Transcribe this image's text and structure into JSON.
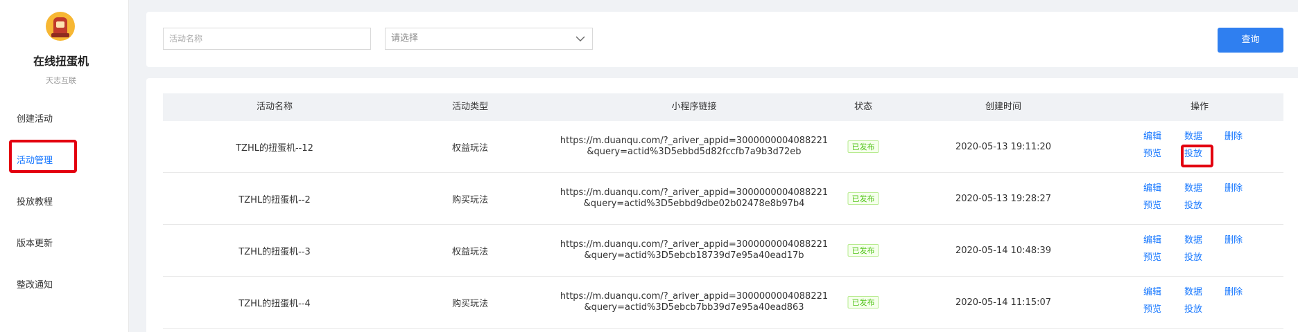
{
  "sidebar": {
    "app_title": "在线扭蛋机",
    "app_subtitle": "天志互联",
    "logo_icon": "gashapon-machine-icon",
    "items": [
      {
        "label": "创建活动",
        "active": false
      },
      {
        "label": "活动管理",
        "active": true
      },
      {
        "label": "投放教程",
        "active": false
      },
      {
        "label": "版本更新",
        "active": false
      },
      {
        "label": "整改通知",
        "active": false
      }
    ]
  },
  "filters": {
    "name_placeholder": "活动名称",
    "type_select_value": "请选择",
    "query_button": "查询"
  },
  "table": {
    "headers": [
      "活动名称",
      "活动类型",
      "小程序链接",
      "状态",
      "创建时间",
      "操作"
    ],
    "rows": [
      {
        "name": "TZHL的扭蛋机--12",
        "type": "权益玩法",
        "link_line1": "https://m.duanqu.com/?_ariver_appid=3000000004088221",
        "link_line2": "&query=actid%3D5ebbd5d82fccfb7a9b3d72eb",
        "status": "已发布",
        "created": "2020-05-13 19:11:20",
        "ops": [
          "编辑",
          "数据",
          "删除",
          "预览",
          "投放"
        ]
      },
      {
        "name": "TZHL的扭蛋机--2",
        "type": "购买玩法",
        "link_line1": "https://m.duanqu.com/?_ariver_appid=3000000004088221",
        "link_line2": "&query=actid%3D5ebbd9dbe02b02478e8b97b4",
        "status": "已发布",
        "created": "2020-05-13 19:28:27",
        "ops": [
          "编辑",
          "数据",
          "删除",
          "预览",
          "投放"
        ]
      },
      {
        "name": "TZHL的扭蛋机--3",
        "type": "权益玩法",
        "link_line1": "https://m.duanqu.com/?_ariver_appid=3000000004088221",
        "link_line2": "&query=actid%3D5ebcb18739d7e95a40ead17b",
        "status": "已发布",
        "created": "2020-05-14 10:48:39",
        "ops": [
          "编辑",
          "数据",
          "删除",
          "预览",
          "投放"
        ]
      },
      {
        "name": "TZHL的扭蛋机--4",
        "type": "购买玩法",
        "link_line1": "https://m.duanqu.com/?_ariver_appid=3000000004088221",
        "link_line2": "&query=actid%3D5ebcb7bb39d7e95a40ead863",
        "status": "已发布",
        "created": "2020-05-14 11:15:07",
        "ops": [
          "编辑",
          "数据",
          "删除",
          "预览",
          "投放"
        ]
      }
    ]
  },
  "colors": {
    "accent": "#1677ff",
    "highlight": "#e3000f",
    "published_green": "#52c41a"
  }
}
